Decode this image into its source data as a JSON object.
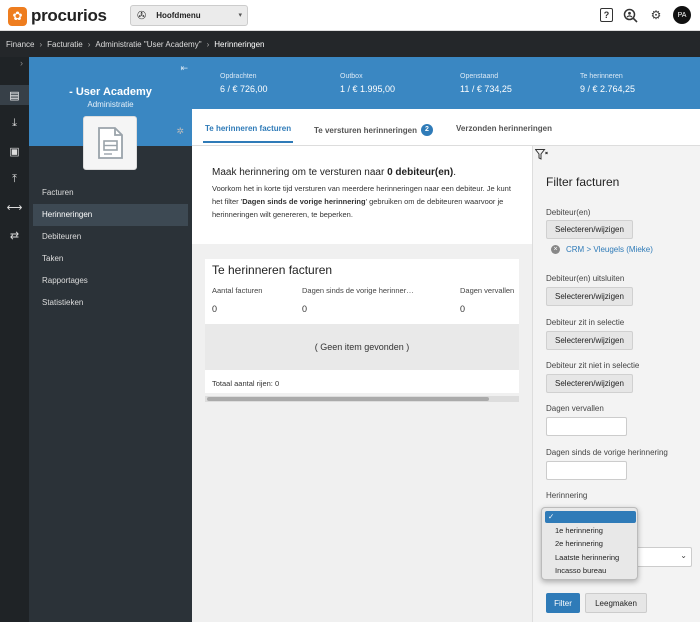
{
  "app": {
    "brand": "procurios"
  },
  "header": {
    "main_menu": "Hoofdmenu",
    "user_initials": "PA"
  },
  "breadcrumb": [
    "Finance",
    "Facturatie",
    "Administratie \"User Academy\"",
    "Herinneringen"
  ],
  "sidebar": {
    "title": "- User Academy",
    "subtitle": "Administratie",
    "items": [
      {
        "label": "Facturen"
      },
      {
        "label": "Herinneringen"
      },
      {
        "label": "Debiteuren"
      },
      {
        "label": "Taken"
      },
      {
        "label": "Rapportages"
      },
      {
        "label": "Statistieken"
      }
    ]
  },
  "stats": [
    {
      "label": "Opdrachten",
      "value": "6 / € 726,00"
    },
    {
      "label": "Outbox",
      "value": "1 / € 1.995,00"
    },
    {
      "label": "Openstaand",
      "value": "11 / € 734,25"
    },
    {
      "label": "Te herinneren",
      "value": "9 / € 2.764,25"
    }
  ],
  "tabs": [
    {
      "label": "Te herinneren facturen"
    },
    {
      "label": "Te versturen herinneringen",
      "badge": "2"
    },
    {
      "label": "Verzonden herinneringen"
    }
  ],
  "info": {
    "line1_pre": "Maak herinnering om te versturen naar ",
    "line1_bold": "0 debiteur(en)",
    "line1_post": ".",
    "body_pre": "Voorkom het in korte tijd versturen van meerdere herinneringen naar een debiteur. Je kunt het filter '",
    "body_bold": "Dagen sinds de vorige herinnering",
    "body_post": "' gebruiken om de debiteuren waarvoor je herinneringen wilt genereren, te beperken."
  },
  "table": {
    "title": "Te herinneren facturen",
    "columns": [
      "Aantal facturen",
      "Dagen sinds de vorige herinner…",
      "Dagen vervallen"
    ],
    "values": [
      "0",
      "0",
      "0"
    ],
    "empty": "( Geen item gevonden )",
    "total": "Totaal aantal rijen: 0"
  },
  "filter": {
    "title": "Filter facturen",
    "debiteur_label": "Debiteur(en)",
    "select_button": "Selecteren/wijzigen",
    "debiteur_chip": "CRM > Vleugels (Mieke)",
    "uitsluiten_label": "Debiteur(en) uitsluiten",
    "in_selectie_label": "Debiteur zit in selectie",
    "niet_in_selectie_label": "Debiteur zit niet in selectie",
    "dagen_vervallen_label": "Dagen vervallen",
    "dagen_sinds_label": "Dagen sinds de vorige herinnering",
    "herinnering_label": "Herinnering",
    "herinnering_options": [
      "",
      "1e herinnering",
      "2e herinnering",
      "Laatste herinnering",
      "Incasso bureau"
    ],
    "herinnering_selected_index": 0,
    "filter_button": "Filter",
    "clear_button": "Leegmaken"
  },
  "colors": {
    "accent": "#3a87c2",
    "sidebar": "#2b3238",
    "topbar_dark": "#24272a",
    "brand_orange": "#ee7d1f"
  }
}
